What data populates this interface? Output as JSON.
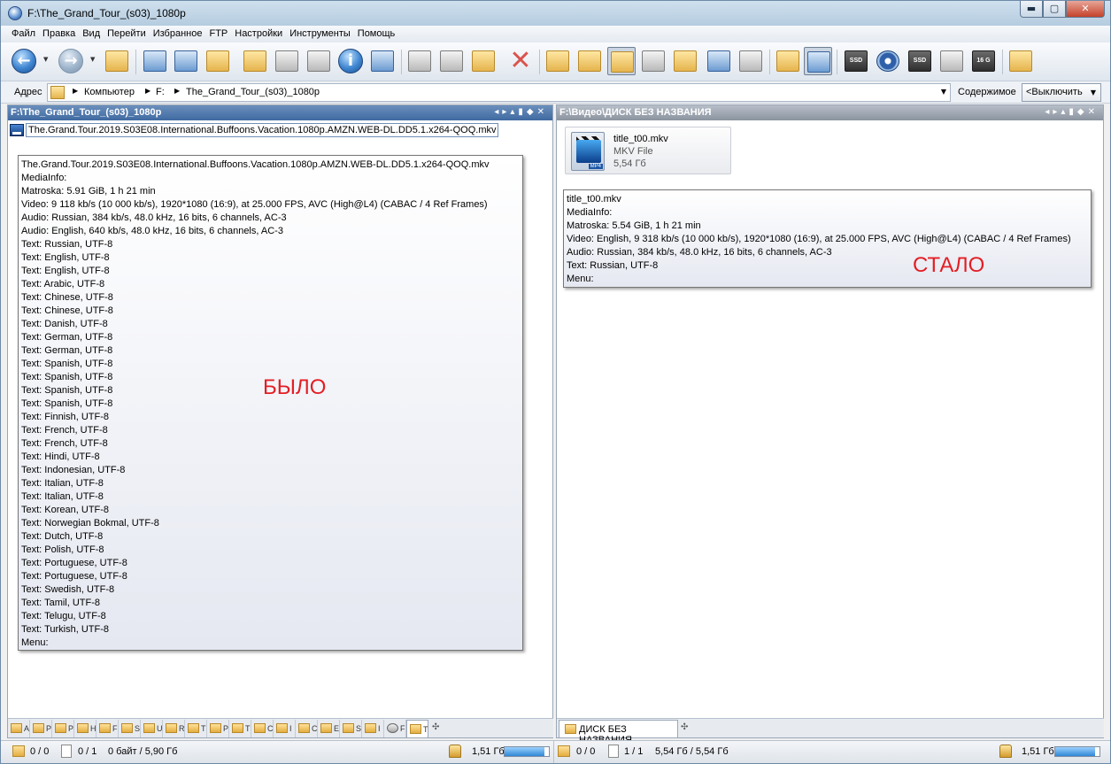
{
  "window": {
    "title": "F:\\The_Grand_Tour_(s03)_1080p",
    "caption_buttons": [
      "minimize",
      "maximize",
      "close"
    ]
  },
  "menu": [
    "Файл",
    "Правка",
    "Вид",
    "Перейти",
    "Избранное",
    "FTP",
    "Настройки",
    "Инструменты",
    "Помощь"
  ],
  "toolbar_icons": [
    "back-arrow-icon",
    "forward-arrow-icon",
    "folder-up-icon",
    "computer-icon",
    "edit-icon",
    "rename-icon",
    "new-folder-icon",
    "filter-icon",
    "select-icon",
    "info-icon",
    "copy-panels-icon",
    "cut-icon",
    "copy-icon",
    "paste-icon",
    "delete-icon",
    "view-list-icon",
    "view-small-icon",
    "view-tiles-icon",
    "view-details-icon",
    "view-large-icon",
    "view-thumbs-icon",
    "view-check-icon",
    "panels-icon",
    "dual-panel-icon",
    "ssd-icon",
    "disc-icon",
    "ssd2-icon",
    "hdd-icon",
    "sd-card-icon",
    "exit-icon"
  ],
  "toolbar_icon_labels": {
    "ssd": "SSD",
    "sd": "16 G"
  },
  "address": {
    "label": "Адрес",
    "crumbs": [
      "Компьютер",
      "F:",
      "The_Grand_Tour_(s03)_1080p"
    ],
    "content_label": "Содержимое",
    "content_value": "<Выключить"
  },
  "left_panel": {
    "path": "F:\\The_Grand_Tour_(s03)_1080p",
    "selected_file": "The.Grand.Tour.2019.S03E08.International.Buffoons.Vacation.1080p.AMZN.WEB-DL.DD5.1.x264-QOQ.mkv",
    "info_lines": [
      "The.Grand.Tour.2019.S03E08.International.Buffoons.Vacation.1080p.AMZN.WEB-DL.DD5.1.x264-QOQ.mkv",
      "MediaInfo:",
      "Matroska: 5.91 GiB, 1 h 21 min",
      "Video: 9 118 kb/s (10 000 kb/s), 1920*1080 (16:9), at 25.000 FPS, AVC (High@L4) (CABAC / 4 Ref Frames)",
      "Audio: Russian, 384 kb/s, 48.0 kHz, 16 bits, 6 channels, AC-3",
      "Audio: English, 640 kb/s, 48.0 kHz, 16 bits, 6 channels, AC-3",
      "Text: Russian, UTF-8",
      "Text: English, UTF-8",
      "Text: English, UTF-8",
      "Text: Arabic, UTF-8",
      "Text: Chinese, UTF-8",
      "Text: Chinese, UTF-8",
      "Text: Danish, UTF-8",
      "Text: German, UTF-8",
      "Text: German, UTF-8",
      "Text: Spanish, UTF-8",
      "Text: Spanish, UTF-8",
      "Text: Spanish, UTF-8",
      "Text: Spanish, UTF-8",
      "Text: Finnish, UTF-8",
      "Text: French, UTF-8",
      "Text: French, UTF-8",
      "Text: Hindi, UTF-8",
      "Text: Indonesian, UTF-8",
      "Text: Italian, UTF-8",
      "Text: Italian, UTF-8",
      "Text: Korean, UTF-8",
      "Text: Norwegian Bokmal, UTF-8",
      "Text: Dutch, UTF-8",
      "Text: Polish, UTF-8",
      "Text: Portuguese, UTF-8",
      "Text: Portuguese, UTF-8",
      "Text: Swedish, UTF-8",
      "Text: Tamil, UTF-8",
      "Text: Telugu, UTF-8",
      "Text: Turkish, UTF-8",
      "Menu:"
    ],
    "annotation": "БЫЛО",
    "tabs": [
      "A",
      "P",
      "P",
      "H",
      "F",
      "S",
      "U",
      "R",
      "T",
      "P",
      "T",
      "C",
      "I",
      "C",
      "E",
      "S",
      "I",
      "F",
      "T"
    ]
  },
  "right_panel": {
    "path": "F:\\Видео\\ДИСК БЕЗ НАЗВАНИЯ",
    "tile": {
      "name": "title_t00.mkv",
      "type": "MKV File",
      "size": "5,54 Гб",
      "badge": "MP4"
    },
    "info_lines": [
      "title_t00.mkv",
      "MediaInfo:",
      "Matroska: 5.54 GiB, 1 h 21 min",
      "Video: English, 9 318 kb/s (10 000 kb/s), 1920*1080 (16:9), at 25.000 FPS, AVC (High@L4) (CABAC / 4 Ref Frames)",
      "Audio: Russian, 384 kb/s, 48.0 kHz, 16 bits, 6 channels, AC-3",
      "Text: Russian, UTF-8",
      "Menu:"
    ],
    "annotation": "СТАЛО",
    "tab": "ДИСК БЕЗ НАЗВАНИЯ"
  },
  "status_left": {
    "folders": "0 / 0",
    "files": "0 / 1",
    "size": "0 байт / 5,90 Гб",
    "free": "1,51 Гб",
    "free_fraction": 0.9
  },
  "status_right": {
    "folders": "0 / 0",
    "files": "1 / 1",
    "size": "5,54 Гб / 5,54 Гб",
    "free": "1,51 Гб",
    "free_fraction": 0.9
  }
}
